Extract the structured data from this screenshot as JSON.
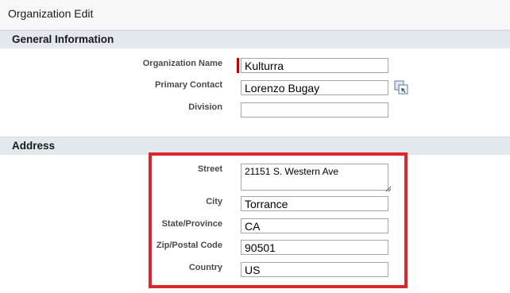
{
  "page": {
    "title": "Organization Edit"
  },
  "sections": {
    "general": {
      "header": "General Information",
      "org_name_label": "Organization Name",
      "org_name_value": "Kulturra",
      "primary_contact_label": "Primary Contact",
      "primary_contact_value": "Lorenzo Bugay",
      "division_label": "Division",
      "division_value": ""
    },
    "address": {
      "header": "Address",
      "street_label": "Street",
      "street_value": "21151 S. Western Ave",
      "city_label": "City",
      "city_value": "Torrance",
      "state_label": "State/Province",
      "state_value": "CA",
      "zip_label": "Zip/Postal Code",
      "zip_value": "90501",
      "country_label": "Country",
      "country_value": "US"
    }
  },
  "icons": {
    "lookup": "lookup-icon",
    "required": "required-indicator"
  },
  "colors": {
    "required": "#c00000",
    "highlight": "#e0242c",
    "section_bg": "#e3e7ee"
  }
}
